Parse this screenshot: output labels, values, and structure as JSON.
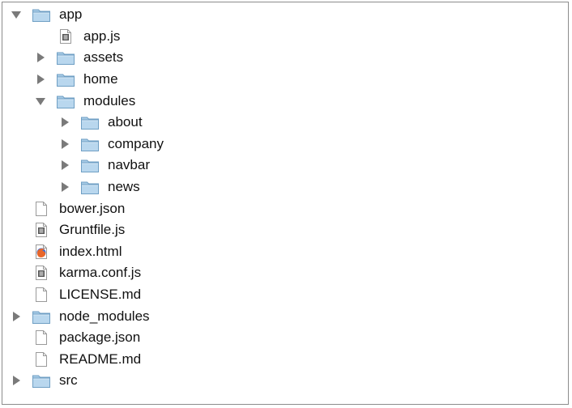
{
  "tree": [
    {
      "label": "app",
      "kind": "folder",
      "depth": 0,
      "state": "expanded"
    },
    {
      "label": "app.js",
      "kind": "js",
      "depth": 1,
      "state": "none"
    },
    {
      "label": "assets",
      "kind": "folder",
      "depth": 1,
      "state": "collapsed"
    },
    {
      "label": "home",
      "kind": "folder",
      "depth": 1,
      "state": "collapsed"
    },
    {
      "label": "modules",
      "kind": "folder",
      "depth": 1,
      "state": "expanded"
    },
    {
      "label": "about",
      "kind": "folder",
      "depth": 2,
      "state": "collapsed"
    },
    {
      "label": "company",
      "kind": "folder",
      "depth": 2,
      "state": "collapsed"
    },
    {
      "label": "navbar",
      "kind": "folder",
      "depth": 2,
      "state": "collapsed"
    },
    {
      "label": "news",
      "kind": "folder",
      "depth": 2,
      "state": "collapsed"
    },
    {
      "label": "bower.json",
      "kind": "doc",
      "depth": 0,
      "state": "none"
    },
    {
      "label": "Gruntfile.js",
      "kind": "js",
      "depth": 0,
      "state": "none"
    },
    {
      "label": "index.html",
      "kind": "html",
      "depth": 0,
      "state": "none"
    },
    {
      "label": "karma.conf.js",
      "kind": "js",
      "depth": 0,
      "state": "none"
    },
    {
      "label": "LICENSE.md",
      "kind": "doc",
      "depth": 0,
      "state": "none"
    },
    {
      "label": "node_modules",
      "kind": "folder",
      "depth": 0,
      "state": "collapsed"
    },
    {
      "label": "package.json",
      "kind": "doc",
      "depth": 0,
      "state": "none"
    },
    {
      "label": "README.md",
      "kind": "doc",
      "depth": 0,
      "state": "none"
    },
    {
      "label": "src",
      "kind": "folder",
      "depth": 0,
      "state": "collapsed"
    }
  ],
  "colors": {
    "folder": "#a7cbe6",
    "folder_edge": "#6f9fc4",
    "triangle": "#7a7a7a",
    "border": "#8c8c8c"
  }
}
